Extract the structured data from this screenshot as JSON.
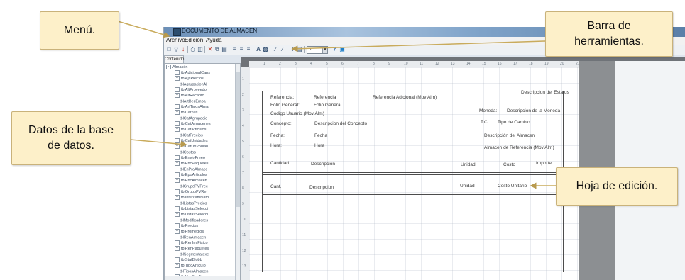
{
  "callouts": {
    "menu": "Menú.",
    "toolbar": "Barra de herramientas.",
    "database": "Datos de la base de datos.",
    "edit_sheet": "Hoja de edición."
  },
  "window": {
    "title": "DOCUMENTO DE ALMACEN"
  },
  "menubar": {
    "items": [
      "Archivo",
      "Edición",
      "Ayuda"
    ]
  },
  "toolbar": {
    "combo_value": "5",
    "icons": [
      "new-icon",
      "open-icon",
      "save-icon",
      "print-icon",
      "preview-icon",
      "delete-icon",
      "copy-icon",
      "paste-icon",
      "align-left-icon",
      "align-center-icon",
      "align-right-icon",
      "text-icon",
      "image-icon",
      "field-icon",
      "line-icon",
      "column-icon",
      "table-icon",
      "help-icon",
      "info-icon"
    ]
  },
  "left_panel": {
    "tab_label": "Contenido",
    "root": "Almacén",
    "items": [
      "tblAdicionalCaps",
      "tblAjsPrecios",
      "tblAgrupacionAl",
      "tblAltProveedor",
      "tblAltRecanto",
      "tblArtBesEmpa",
      "tblArtTiposAlma",
      "tblCarnes",
      "tblCatAgrupacio",
      "tblCatAlmacenes",
      "tblCatArticulos",
      "tblCatPrecios",
      "tblCatUnidades",
      "tblCatUnVoulan",
      "tblCostos",
      "tblEnvioFreeo",
      "tblEncPaquetes",
      "tblEnPreAlmace",
      "tblEpoArticulos",
      "tblEncAlmacen",
      "tblGrupoPVPrec",
      "tblGrupoPVRef",
      "tblIntercambiato",
      "tblListasPrecios",
      "tblListasSelecci",
      "tblListasSelecdi",
      "tblModificadores",
      "tblPrecios",
      "tblPromedios",
      "tblRenAlmacen",
      "tblRenInvFisico",
      "tblRenPaquetes",
      "tblSegmentatexe",
      "tblStatBlobb",
      "tblTipoArticulo",
      "tblTiposAlmacen",
      "tblUsuCanfigura"
    ]
  },
  "rulers": {
    "horizontal": [
      "1",
      "2",
      "3",
      "4",
      "5",
      "6",
      "7",
      "8",
      "9",
      "10",
      "11",
      "12",
      "13",
      "14",
      "15",
      "16",
      "17",
      "18",
      "19",
      "20",
      "21"
    ],
    "vertical": [
      "1",
      "2",
      "3",
      "4",
      "5",
      "6",
      "7",
      "8",
      "9",
      "10",
      "11",
      "12",
      "13"
    ]
  },
  "form": {
    "referencia_label": "Referencia:",
    "referencia_value": "Referencia",
    "ref_adicional": "Referencia Adicional (Mov Alm)",
    "desc_estatus": "Descripcion del Estatus",
    "folio_label": "Folio General:",
    "folio_value": "Folio General",
    "codigo_usuario": "Codigo Usuario (Mov Alm)",
    "moneda_label": "Moneda:",
    "moneda_value": "Descripcion de la Moneda",
    "concepto_label": "Concepto:",
    "concepto_value": "Descripcion del Concepto",
    "tc_label": "T.C.",
    "tc_value": "Tipo de Cambio",
    "fecha_label": "Fecha:",
    "fecha_value": "Fecha",
    "desc_almacen": "Descripción del Almacen",
    "hora_label": "Hora:",
    "hora_value": "Hora",
    "almacen_ref": "Almacen de Referencia (Mov Alm)",
    "col_cantidad": "Cantidad",
    "col_descripcion": "Descripción",
    "col_unidad": "Unidad",
    "col_costo": "Costo",
    "col_importe": "Importe",
    "row_cant": "Cant.",
    "row_descripcion": "Descripcion",
    "row_unidad": "Unidad",
    "row_costo": "Costo Unitario"
  }
}
